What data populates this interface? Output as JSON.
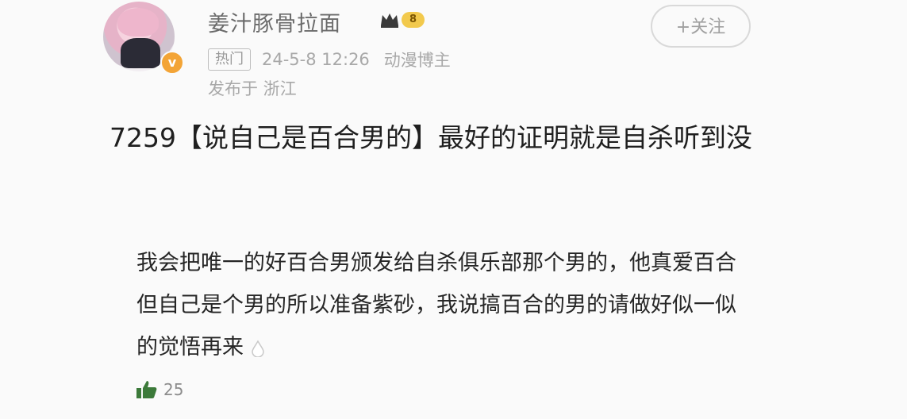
{
  "author": {
    "name": "姜汁豚骨拉面",
    "level": "8",
    "follow_label": "+关注",
    "hot_tag": "热门",
    "timestamp": "24-5-8 12:26",
    "role": "动漫博主",
    "location": "发布于 浙江"
  },
  "post": {
    "title": "7259【说自己是百合男的】最好的证明就是自杀听到没",
    "body": "我会把唯一的好百合男颁发给自杀俱乐部那个男的，他真爱百合但自己是个男的所以准备紫砂，我说搞百合的男的请做好似一似的觉悟再来"
  },
  "actions": {
    "like_count": "25"
  },
  "icons": {
    "like": "thumbs-up-icon",
    "verify": "verified-badge-icon",
    "crown": "crown-icon",
    "drop": "water-drop-emoji-icon"
  },
  "colors": {
    "level_badge": "#f2c94c",
    "verify_badge": "#f3a436",
    "like_icon": "#3c7a3a"
  }
}
